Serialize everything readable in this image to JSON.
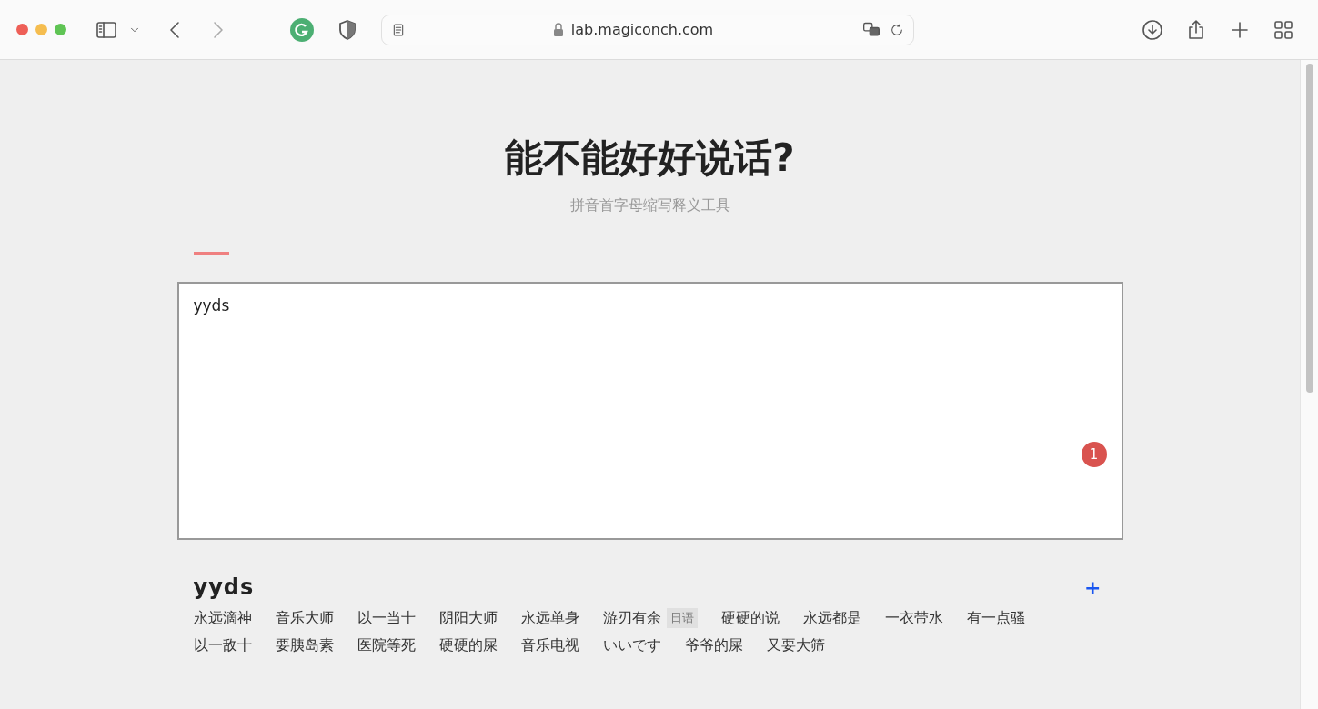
{
  "browser": {
    "url": "lab.magiconch.com"
  },
  "page": {
    "title": "能不能好好说话?",
    "subtitle": "拼音首字母缩写释义工具"
  },
  "input": {
    "value": "yyds",
    "badge": "1"
  },
  "results": [
    {
      "term": "yyds",
      "add": "+",
      "words": [
        {
          "text": "永远滴神"
        },
        {
          "text": "音乐大师"
        },
        {
          "text": "以一当十"
        },
        {
          "text": "阴阳大师"
        },
        {
          "text": "永远单身"
        },
        {
          "text": "游刃有余",
          "tag": "日语"
        },
        {
          "text": "硬硬的说"
        },
        {
          "text": "永远都是"
        },
        {
          "text": "一衣带水"
        },
        {
          "text": "有一点骚"
        },
        {
          "text": "以一敌十"
        },
        {
          "text": "要胰岛素"
        },
        {
          "text": "医院等死"
        },
        {
          "text": "硬硬的屎"
        },
        {
          "text": "音乐电视"
        },
        {
          "text": "いいです"
        },
        {
          "text": "爷爷的屎"
        },
        {
          "text": "又要大筛"
        }
      ]
    }
  ]
}
